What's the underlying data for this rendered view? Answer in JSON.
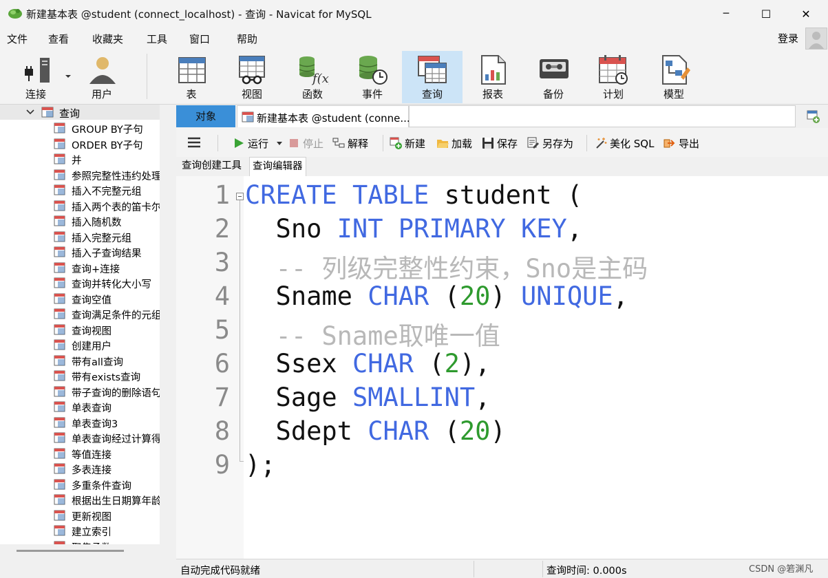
{
  "window": {
    "title": "新建基本表 @student (connect_localhost) - 查询 - Navicat for MySQL",
    "minimize_glyph": "─",
    "maximize_glyph": "☐",
    "close_glyph": "✕"
  },
  "menu": {
    "items": [
      "文件",
      "查看",
      "收藏夹",
      "工具",
      "窗口",
      "帮助"
    ],
    "login": "登录"
  },
  "toolbar": {
    "items": [
      {
        "label": "连接",
        "icon": "connect-icon"
      },
      {
        "label": "用户",
        "icon": "user-icon"
      },
      {
        "label": "表",
        "icon": "table-icon"
      },
      {
        "label": "视图",
        "icon": "view-icon"
      },
      {
        "label": "函数",
        "icon": "function-icon"
      },
      {
        "label": "事件",
        "icon": "event-icon"
      },
      {
        "label": "查询",
        "icon": "query-icon",
        "active": true
      },
      {
        "label": "报表",
        "icon": "report-icon"
      },
      {
        "label": "备份",
        "icon": "backup-icon"
      },
      {
        "label": "计划",
        "icon": "schedule-icon"
      },
      {
        "label": "模型",
        "icon": "model-icon"
      }
    ]
  },
  "sidebar": {
    "root": "查询",
    "items": [
      "GROUP BY子句",
      "ORDER BY子句",
      "并",
      "参照完整性违约处理",
      "插入不完整元组",
      "插入两个表的笛卡尔积",
      "插入随机数",
      "插入完整元组",
      "插入子查询结果",
      "查询+连接",
      "查询并转化大小写",
      "查询空值",
      "查询满足条件的元组",
      "查询视图",
      "创建用户",
      "带有all查询",
      "带有exists查询",
      "带子查询的删除语句",
      "单表查询",
      "单表查询3",
      "单表查询经过计算得",
      "等值连接",
      "多表连接",
      "多重条件查询",
      "根据出生日期算年龄",
      "更新视图",
      "建立索引",
      "聚集函数"
    ]
  },
  "tabs": {
    "objects": "对象",
    "document": "新建基本表 @student (conne..."
  },
  "editor_toolbar": {
    "run": "运行",
    "stop": "停止",
    "explain": "解释",
    "new": "新建",
    "load": "加载",
    "save": "保存",
    "save_as": "另存为",
    "beautify": "美化 SQL",
    "export": "导出"
  },
  "subtabs": [
    "查询创建工具",
    "查询编辑器"
  ],
  "code": {
    "lines": [
      {
        "n": "1",
        "segs": [
          {
            "t": "CREATE",
            "c": "kw"
          },
          {
            "t": " ",
            "c": "id"
          },
          {
            "t": "TABLE",
            "c": "kw"
          },
          {
            "t": " student (",
            "c": "id"
          }
        ]
      },
      {
        "n": "2",
        "segs": [
          {
            "t": "  Sno ",
            "c": "id"
          },
          {
            "t": "INT",
            "c": "kw"
          },
          {
            "t": " ",
            "c": "id"
          },
          {
            "t": "PRIMARY",
            "c": "kw"
          },
          {
            "t": " ",
            "c": "id"
          },
          {
            "t": "KEY",
            "c": "kw"
          },
          {
            "t": ",",
            "c": "id"
          }
        ]
      },
      {
        "n": "3",
        "segs": [
          {
            "t": "  -- 列级完整性约束，Sno是主码",
            "c": "cmt"
          }
        ]
      },
      {
        "n": "4",
        "segs": [
          {
            "t": "  Sname ",
            "c": "id"
          },
          {
            "t": "CHAR",
            "c": "kw"
          },
          {
            "t": " (",
            "c": "id"
          },
          {
            "t": "20",
            "c": "num"
          },
          {
            "t": ") ",
            "c": "id"
          },
          {
            "t": "UNIQUE",
            "c": "kw"
          },
          {
            "t": ",",
            "c": "id"
          }
        ]
      },
      {
        "n": "5",
        "segs": [
          {
            "t": "  -- Sname取唯一值",
            "c": "cmt"
          }
        ]
      },
      {
        "n": "6",
        "segs": [
          {
            "t": "  Ssex ",
            "c": "id"
          },
          {
            "t": "CHAR",
            "c": "kw"
          },
          {
            "t": " (",
            "c": "id"
          },
          {
            "t": "2",
            "c": "num"
          },
          {
            "t": "),",
            "c": "id"
          }
        ]
      },
      {
        "n": "7",
        "segs": [
          {
            "t": "  Sage ",
            "c": "id"
          },
          {
            "t": "SMALLINT",
            "c": "kw"
          },
          {
            "t": ",",
            "c": "id"
          }
        ]
      },
      {
        "n": "8",
        "segs": [
          {
            "t": "  Sdept ",
            "c": "id"
          },
          {
            "t": "CHAR",
            "c": "kw"
          },
          {
            "t": " (",
            "c": "id"
          },
          {
            "t": "20",
            "c": "num"
          },
          {
            "t": ")",
            "c": "id"
          }
        ]
      },
      {
        "n": "9",
        "segs": [
          {
            "t": ");",
            "c": "id"
          }
        ]
      }
    ]
  },
  "status": {
    "left": "自动完成代码就绪",
    "right": "查询时间: 0.000s",
    "watermark": "CSDN @箬渊凡"
  },
  "colors": {
    "keyword": "#4169e1",
    "number": "#2e9a2e",
    "comment": "#b8b8b8",
    "objects_tab": "#3a8fd8",
    "active_tool": "#cce4f7"
  }
}
